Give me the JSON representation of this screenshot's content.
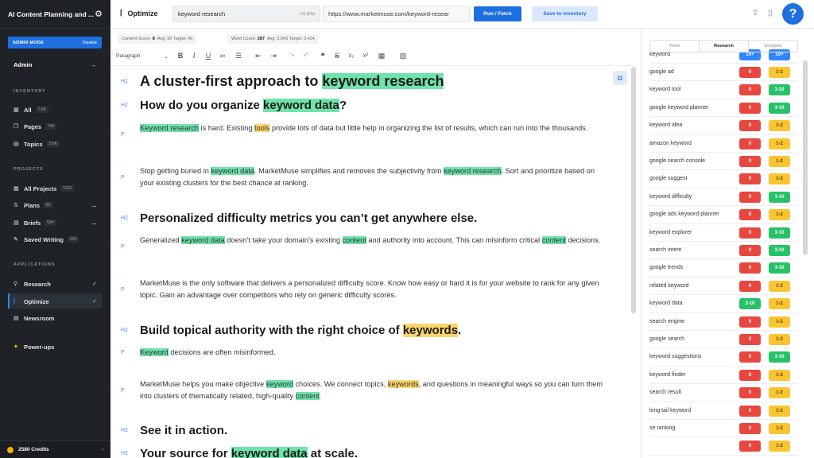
{
  "sidebar": {
    "title": "AI Content Planning and ...",
    "admin_mode": "ADMIN MODE",
    "disable": "Disable",
    "admin": "Admin",
    "inventory_label": "INVENTORY",
    "inventory": [
      {
        "label": "All",
        "count": "7.5K"
      },
      {
        "label": "Pages",
        "count": "740"
      },
      {
        "label": "Topics",
        "count": "5.6K"
      }
    ],
    "projects_label": "PROJECTS",
    "projects": [
      {
        "label": "All Projects",
        "count": "1120"
      },
      {
        "label": "Plans",
        "count": "82"
      },
      {
        "label": "Briefs",
        "count": "534"
      },
      {
        "label": "Saved Writing",
        "count": "219"
      }
    ],
    "applications_label": "APPLICATIONS",
    "applications": [
      {
        "label": "Research"
      },
      {
        "label": "Optimize"
      },
      {
        "label": "Newsroom"
      }
    ],
    "powerups": "Power-ups",
    "credits": "2580 Credits"
  },
  "topbar": {
    "app_name": "Optimize",
    "keyword": "keyword research",
    "locale": "US (EN)",
    "url": "https://www.marketmuse.com/keyword-resear",
    "run_label": "Run / Fetch",
    "save_label": "Save to inventory"
  },
  "scores": {
    "content_label": "Content Score:",
    "content_value": "8",
    "content_avg": "Avg: 30",
    "content_target": "Target: 40",
    "wc_label": "Word Count:",
    "wc_value": "287",
    "wc_avg": "Avg: 3,043",
    "wc_target": "Target: 3,424"
  },
  "toolbar": {
    "paragraph": "Paragraph"
  },
  "editor": {
    "tags": {
      "h1": "H1",
      "h2": "H2",
      "p": "P"
    },
    "h1": {
      "pre": "A cluster-first approach to ",
      "hl": "keyword research"
    },
    "h2_1": {
      "pre": "How do you organize ",
      "hl": "keyword data",
      "post": "?"
    },
    "p1": {
      "hl1": "Keyword research",
      "t1": " is hard. Existing ",
      "hl2": "tools",
      "t2": " provide lots of data but little help in organizing the list of results, which can run into the thousands."
    },
    "p2": {
      "t1": "Stop getting buried in ",
      "hl1": "keyword data",
      "t2": ". MarketMuse simplifies and removes the subjectivity from ",
      "hl2": "keyword research",
      "t3": ". Sort and prioritize based on your existing clusters for the best chance at ranking."
    },
    "h2_2": "Personalized difficulty metrics you can’t get anywhere else.",
    "p3": {
      "t1": "Generalized ",
      "hl1": "keyword data",
      "t2": " doesn’t take your domain’s existing ",
      "hl2": "content",
      "t3": " and authority into account. This can misinform critical ",
      "hl3": "content",
      "t4": " decisions."
    },
    "p4": "MarketMuse is the only software that delivers a personalized difficulty score. Know how easy or hard it is for your website to rank for any given topic. Gain an advantage over competitors who rely on generic difficulty scores.",
    "h2_3": {
      "pre": "Build topical authority with the right choice of ",
      "hl": "keywords",
      "post": "."
    },
    "p5": {
      "hl1": "Keyword",
      "t1": " decisions are often misinformed."
    },
    "p6": {
      "t1": "MarketMuse helps you make objective ",
      "hl1": "keyword",
      "t2": " choices. We connect topics, ",
      "hl2": "keywords",
      "t3": ", and questions in meaningful ways so you can turn them into clusters of thematically related, high-quality ",
      "hl3": "content",
      "t4": "."
    },
    "h2_4": "See it in action.",
    "h2_5": {
      "pre": "Your source for ",
      "hl": "keyword data",
      "post": " at scale."
    }
  },
  "panel": {
    "tabs": [
      "Feed",
      "Research",
      "Compete"
    ],
    "rows": [
      {
        "term": "keyword",
        "b1": "10+",
        "b2": "10+"
      },
      {
        "term": "google ad",
        "b1": "0",
        "b2": "1-2"
      },
      {
        "term": "keyword tool",
        "b1": "0",
        "b2": "3-10"
      },
      {
        "term": "google keyword planner",
        "b1": "0",
        "b2": "3-10"
      },
      {
        "term": "keyword idea",
        "b1": "0",
        "b2": "1-2"
      },
      {
        "term": "amazon keyword",
        "b1": "0",
        "b2": "1-2"
      },
      {
        "term": "google search console",
        "b1": "0",
        "b2": "1-2"
      },
      {
        "term": "google suggest",
        "b1": "0",
        "b2": "1-2"
      },
      {
        "term": "keyword difficulty",
        "b1": "0",
        "b2": "3-10"
      },
      {
        "term": "google ads keyword planner",
        "b1": "0",
        "b2": "1-2"
      },
      {
        "term": "keyword explorer",
        "b1": "0",
        "b2": "3-10"
      },
      {
        "term": "search intent",
        "b1": "0",
        "b2": "3-10"
      },
      {
        "term": "google trends",
        "b1": "0",
        "b2": "3-10"
      },
      {
        "term": "related keyword",
        "b1": "0",
        "b2": "1-2"
      },
      {
        "term": "keyword data",
        "b1": "3-10",
        "b2": "1-2"
      },
      {
        "term": "search engine",
        "b1": "0",
        "b2": "1-2"
      },
      {
        "term": "google search",
        "b1": "0",
        "b2": "1-2"
      },
      {
        "term": "keyword suggestions",
        "b1": "0",
        "b2": "3-10"
      },
      {
        "term": "keyword finder",
        "b1": "0",
        "b2": "1-2"
      },
      {
        "term": "search result",
        "b1": "0",
        "b2": "1-2"
      },
      {
        "term": "long tail keyword",
        "b1": "0",
        "b2": "1-2"
      },
      {
        "term": "se ranking",
        "b1": "0",
        "b2": "1-2"
      },
      {
        "term": "",
        "b1": "0",
        "b2": "1-2"
      }
    ]
  },
  "colors": {
    "accent": "#1e6fe0",
    "red_badge": "#e8473f",
    "green_badge": "#27c267",
    "yellow_badge": "#fbc531",
    "blue_badge": "#2f86ff",
    "highlight_green": "#6fe3ac",
    "highlight_yellow": "#fdd56a"
  },
  "icons": {
    "gear": "gear-icon",
    "help": "help-icon",
    "share": "share-icon",
    "document": "document-icon"
  }
}
